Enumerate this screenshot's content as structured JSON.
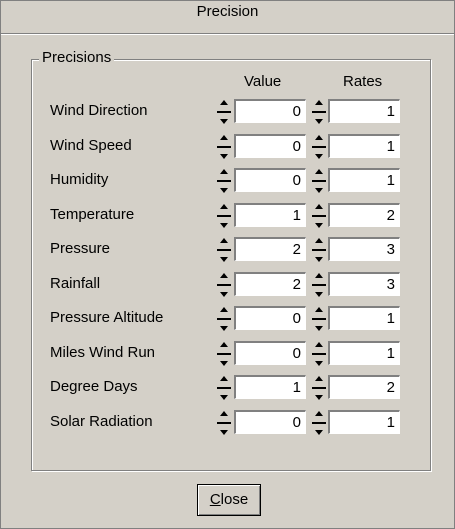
{
  "window": {
    "title": "Precision"
  },
  "group": {
    "label": "Precisions",
    "value_header": "Value",
    "rates_header": "Rates",
    "rows": [
      {
        "label": "Wind Direction",
        "value": "0",
        "rate": "1"
      },
      {
        "label": "Wind Speed",
        "value": "0",
        "rate": "1"
      },
      {
        "label": "Humidity",
        "value": "0",
        "rate": "1"
      },
      {
        "label": "Temperature",
        "value": "1",
        "rate": "2"
      },
      {
        "label": "Pressure",
        "value": "2",
        "rate": "3"
      },
      {
        "label": "Rainfall",
        "value": "2",
        "rate": "3"
      },
      {
        "label": "Pressure Altitude",
        "value": "0",
        "rate": "1"
      },
      {
        "label": "Miles Wind Run",
        "value": "0",
        "rate": "1"
      },
      {
        "label": "Degree Days",
        "value": "1",
        "rate": "2"
      },
      {
        "label": "Solar Radiation",
        "value": "0",
        "rate": "1"
      }
    ]
  },
  "buttons": {
    "close_label_first": "C",
    "close_label_rest": "lose"
  }
}
